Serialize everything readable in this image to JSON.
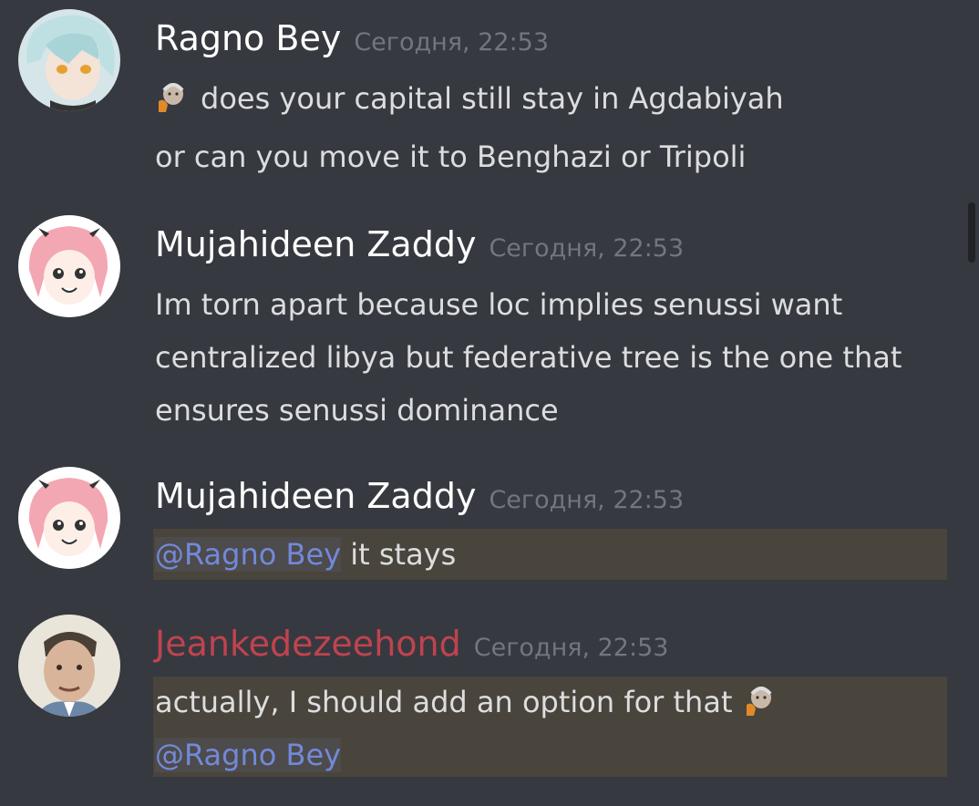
{
  "messages": [
    {
      "username": "Ragno Bey",
      "timestamp": "Сегодня, 22:53",
      "lines": [
        "does your capital still stay in Agdabiyah",
        "or can you move it to Benghazi or Tripoli"
      ],
      "emoji": "old-man-face-emoji"
    },
    {
      "username": "Mujahideen Zaddy",
      "timestamp": "Сегодня, 22:53",
      "lines": [
        "Im torn apart because loc implies senussi want",
        "centralized libya but federative tree is the one that",
        "ensures senussi dominance"
      ]
    },
    {
      "username": "Mujahideen Zaddy",
      "timestamp": "Сегодня, 22:53",
      "mention": "@Ragno Bey",
      "text": "it stays"
    },
    {
      "username": "Jeankedezeehond",
      "username_color": "#c0434f",
      "timestamp": "Сегодня, 22:53",
      "text": "actually, I should add an option for that",
      "mention": "@Ragno Bey",
      "emoji": "old-man-face-emoji"
    }
  ],
  "colors": {
    "background": "#36393f",
    "text": "#dcddde",
    "muted": "#72767d",
    "mention": "#7289da",
    "mention_highlight": "#49443c"
  }
}
